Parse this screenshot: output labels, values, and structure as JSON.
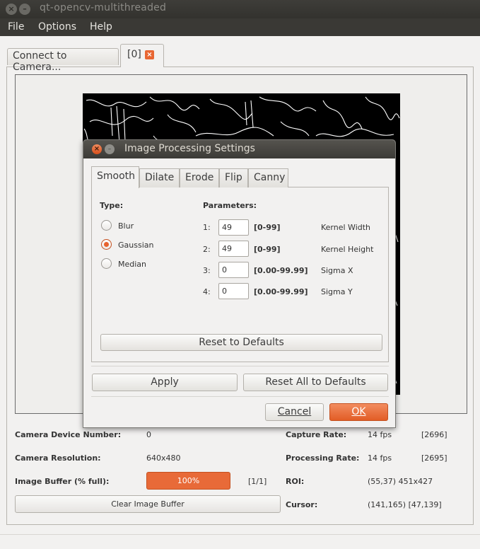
{
  "window": {
    "title": "qt-opencv-multithreaded",
    "close_glyph": "×",
    "minimize_glyph": "–"
  },
  "menu": {
    "items": [
      "File",
      "Options",
      "Help"
    ]
  },
  "tabs": {
    "connect_label": "Connect to Camera...",
    "active_label": "[0]",
    "close_glyph": "×"
  },
  "info": {
    "camera_device_number_label": "Camera Device Number:",
    "camera_device_number_value": "0",
    "camera_resolution_label": "Camera Resolution:",
    "camera_resolution_value": "640x480",
    "image_buffer_label": "Image Buffer (% full):",
    "image_buffer_value": "100%",
    "image_buffer_fill": 1.0,
    "image_buffer_count": "[1/1]",
    "clear_buffer_label": "Clear Image Buffer",
    "capture_rate_label": "Capture Rate:",
    "capture_rate_value": "14 fps",
    "capture_rate_count": "[2696]",
    "processing_rate_label": "Processing Rate:",
    "processing_rate_value": "14 fps",
    "processing_rate_count": "[2695]",
    "roi_label": "ROI:",
    "roi_value": "(55,37) 451x427",
    "cursor_label": "Cursor:",
    "cursor_value": "(141,165) [47,139]"
  },
  "dialog": {
    "title": "Image Processing Settings",
    "tabs": [
      "Smooth",
      "Dilate",
      "Erode",
      "Flip",
      "Canny"
    ],
    "active_tab": "Smooth",
    "type_heading": "Type:",
    "types": [
      {
        "label": "Blur",
        "checked": false
      },
      {
        "label": "Gaussian",
        "checked": true
      },
      {
        "label": "Median",
        "checked": false
      }
    ],
    "parameters_heading": "Parameters:",
    "parameters": [
      {
        "index": "1:",
        "value": "49",
        "range": "[0-99]",
        "name": "Kernel Width"
      },
      {
        "index": "2:",
        "value": "49",
        "range": "[0-99]",
        "name": "Kernel Height"
      },
      {
        "index": "3:",
        "value": "0",
        "range": "[0.00-99.99]",
        "name": "Sigma X"
      },
      {
        "index": "4:",
        "value": "0",
        "range": "[0.00-99.99]",
        "name": "Sigma Y"
      }
    ],
    "reset_defaults_label": "Reset to Defaults",
    "apply_label": "Apply",
    "reset_all_label": "Reset All to Defaults",
    "cancel_label": "Cancel",
    "ok_label": "OK"
  },
  "colors": {
    "accent": "#e86a38",
    "titlebar": "#3c3b37",
    "background": "#f2f1f0"
  }
}
